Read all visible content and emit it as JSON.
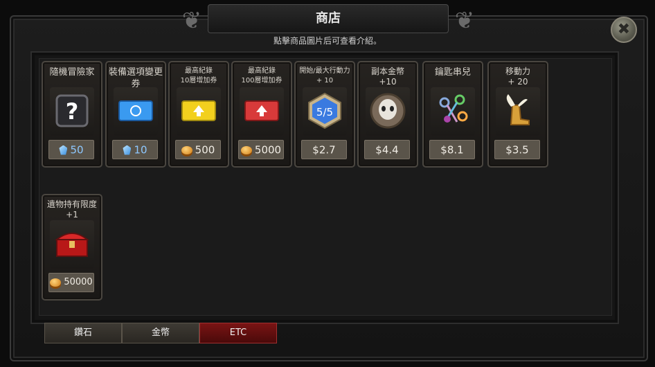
{
  "window": {
    "title": "商店",
    "subtitle": "點擊商品圖片后可查看介紹。",
    "close_icon": "✖"
  },
  "items": [
    {
      "title": "隨機冒險家",
      "icon": "question-mark-icon",
      "currency": "diamond",
      "price": "50"
    },
    {
      "title": "裝備選項變更券",
      "icon": "blue-ticket-icon",
      "currency": "diamond",
      "price": "10"
    },
    {
      "title": "最高紀錄\n10層增加券",
      "icon": "yellow-ticket-icon",
      "currency": "gold",
      "price": "500"
    },
    {
      "title": "最高紀錄\n100層增加券",
      "icon": "red-ticket-icon",
      "currency": "gold",
      "price": "5000"
    },
    {
      "title": "開始/最大行動力\n+ 10",
      "icon": "hexagon-energy-icon",
      "icon_text": "5/5",
      "currency": "cash",
      "price": "$2.7"
    },
    {
      "title": "副本金幣\n+10",
      "icon": "skull-coin-icon",
      "currency": "cash",
      "price": "$4.4"
    },
    {
      "title": "鑰匙串兒",
      "icon": "key-bundle-icon",
      "currency": "cash",
      "price": "$8.1"
    },
    {
      "title": "移動力\n+ 20",
      "icon": "winged-boot-icon",
      "currency": "cash",
      "price": "$3.5"
    },
    {
      "title": "遺物持有限度\n+1",
      "icon": "treasure-chest-icon",
      "currency": "gold",
      "price": "50000"
    }
  ],
  "tabs": [
    {
      "label": "鑽石",
      "active": false
    },
    {
      "label": "金幣",
      "active": false
    },
    {
      "label": "ETC",
      "active": true
    }
  ],
  "colors": {
    "accent_red": "#7a1414",
    "price_plate": "#5a544a",
    "diamond_blue": "#3a8fe0",
    "gold": "#d07a14"
  }
}
